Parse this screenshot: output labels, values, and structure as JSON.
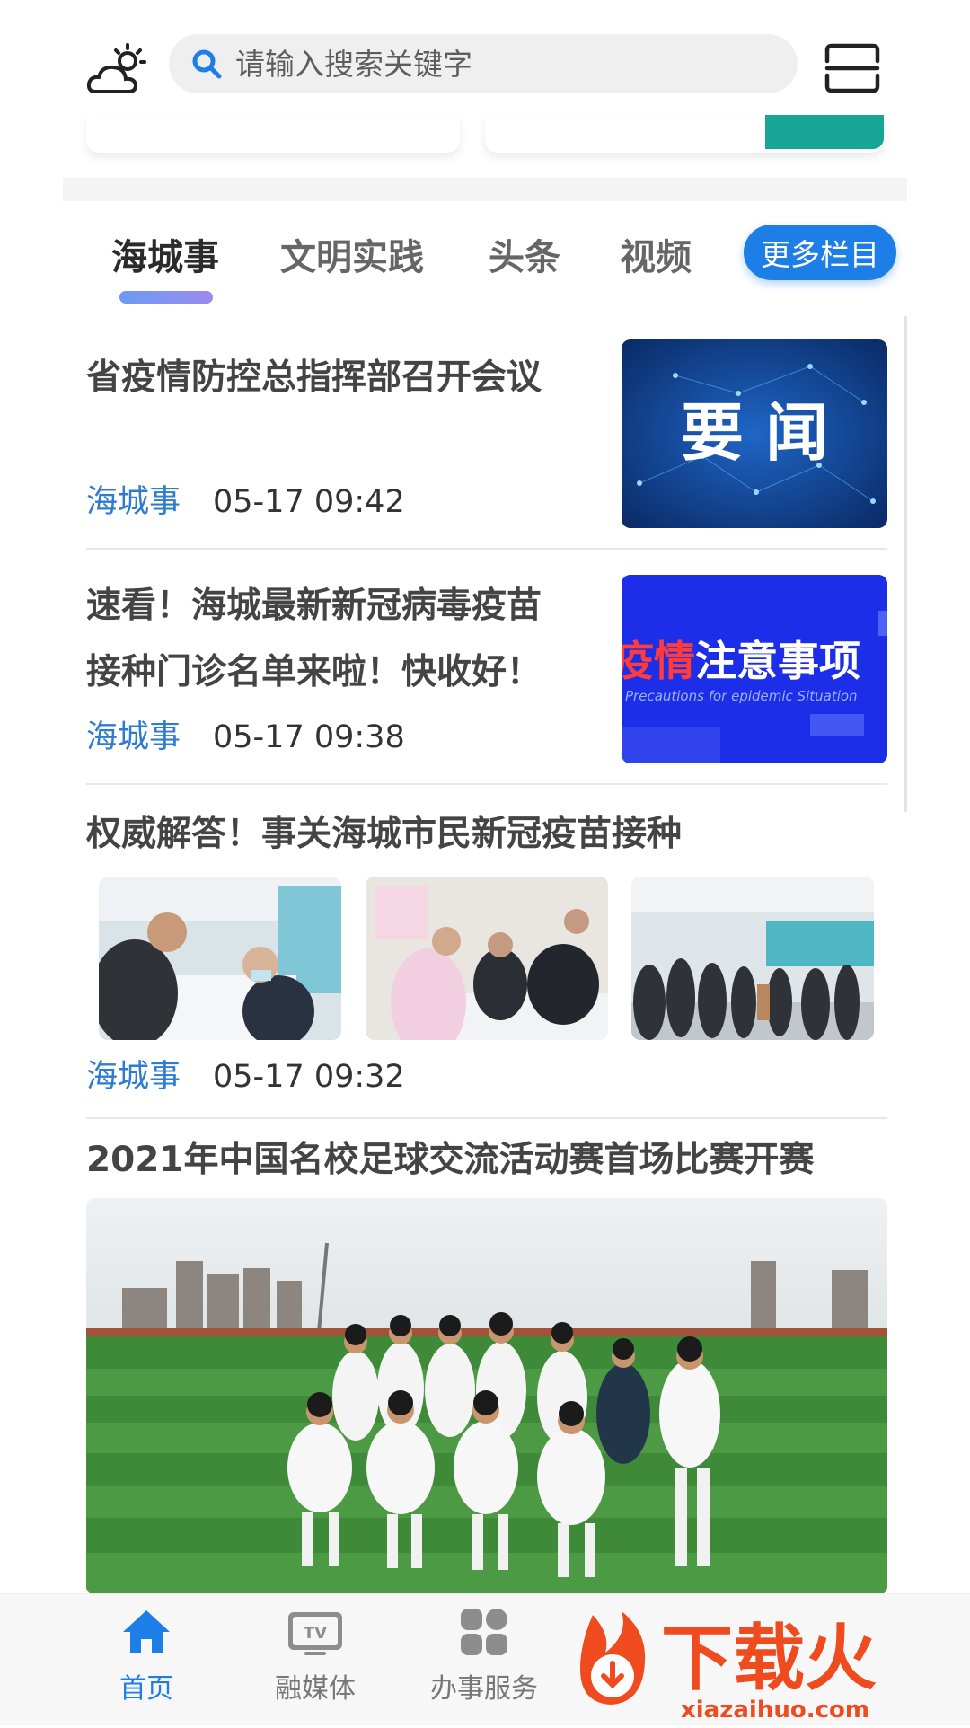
{
  "header": {
    "weather_icon": "cloud-sun-icon",
    "search_placeholder": "请输入搜索关键字",
    "scan_icon": "scan-icon"
  },
  "tabs": {
    "items": [
      {
        "label": "海城事",
        "active": true
      },
      {
        "label": "文明实践",
        "active": false
      },
      {
        "label": "头条",
        "active": false
      },
      {
        "label": "视频",
        "active": false
      }
    ],
    "more_label": "更多栏目",
    "accent": "#1e7ee8"
  },
  "articles": [
    {
      "title": "省疫情防控总指挥部召开会议",
      "source": "海城事",
      "time": "05-17 09:42",
      "thumb_text": "要 闻"
    },
    {
      "title_line1": "速看！海城最新新冠病毒疫苗",
      "title_line2": "接种门诊名单来啦！快收好！",
      "source": "海城事",
      "time": "05-17 09:38",
      "thumb_text_red": "疫情",
      "thumb_text_white": "注意事项",
      "thumb_subtext": "Precautions for epidemic Situation"
    },
    {
      "title": "权威解答！事关海城市民新冠疫苗接种",
      "source": "海城事",
      "time": "05-17 09:32"
    },
    {
      "title": "2021年中国名校足球交流活动赛首场比赛开赛"
    }
  ],
  "bottom_nav": [
    {
      "label": "首页",
      "icon": "home-icon",
      "active": true
    },
    {
      "label": "融媒体",
      "icon": "tv-icon",
      "active": false
    },
    {
      "label": "办事服务",
      "icon": "grid-icon",
      "active": false
    }
  ],
  "watermark": {
    "brand": "下载火",
    "url": "xiazaihuo.com"
  }
}
